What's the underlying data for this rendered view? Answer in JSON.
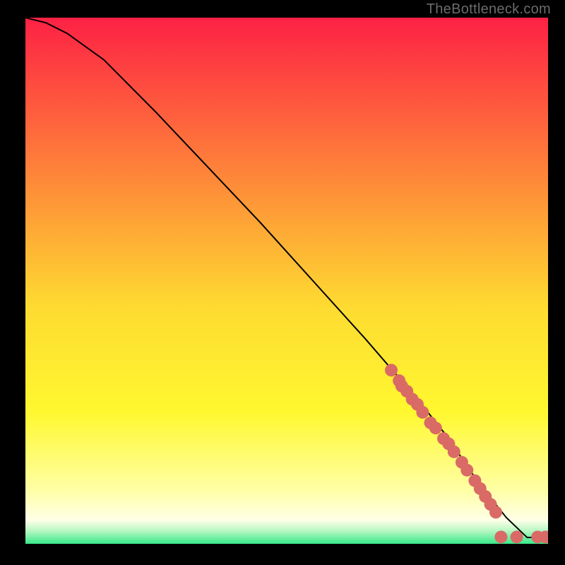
{
  "watermark": "TheBottleneck.com",
  "colors": {
    "gradient_top": "#fd2144",
    "gradient_mid_upper": "#fe7f3a",
    "gradient_mid": "#fedb31",
    "gradient_mid_lower": "#fff82f",
    "gradient_yellow_pale": "#ffffa7",
    "gradient_green": "#37e989",
    "curve": "#000000",
    "marker": "#d96a66",
    "frame": "#000000"
  },
  "chart_data": {
    "type": "line",
    "title": "",
    "xlabel": "",
    "ylabel": "",
    "xlim": [
      0,
      100
    ],
    "ylim": [
      0,
      100
    ],
    "curve": {
      "x": [
        0,
        4,
        8,
        15,
        25,
        35,
        45,
        55,
        65,
        75,
        81,
        83,
        85,
        88,
        92,
        96,
        100
      ],
      "y": [
        100,
        99,
        97,
        92,
        82,
        71.5,
        61,
        50,
        39,
        27.5,
        20,
        17,
        14,
        10,
        5,
        1.2,
        1.2
      ]
    },
    "markers": {
      "note": "Approximate coral data points along the lower segment of the curve and along the floor",
      "x": [
        70,
        71.5,
        72,
        73,
        74,
        75,
        76,
        77.5,
        78.5,
        80,
        81,
        82,
        83.5,
        84.5,
        86,
        87,
        88,
        89,
        90,
        91,
        94,
        98,
        99.5
      ],
      "y": [
        33,
        31,
        30,
        29,
        27.5,
        26.5,
        25,
        23,
        22,
        20,
        19,
        17.5,
        15.5,
        14,
        12,
        10.5,
        9,
        7.5,
        6,
        1.3,
        1.3,
        1.3,
        1.3
      ]
    }
  }
}
